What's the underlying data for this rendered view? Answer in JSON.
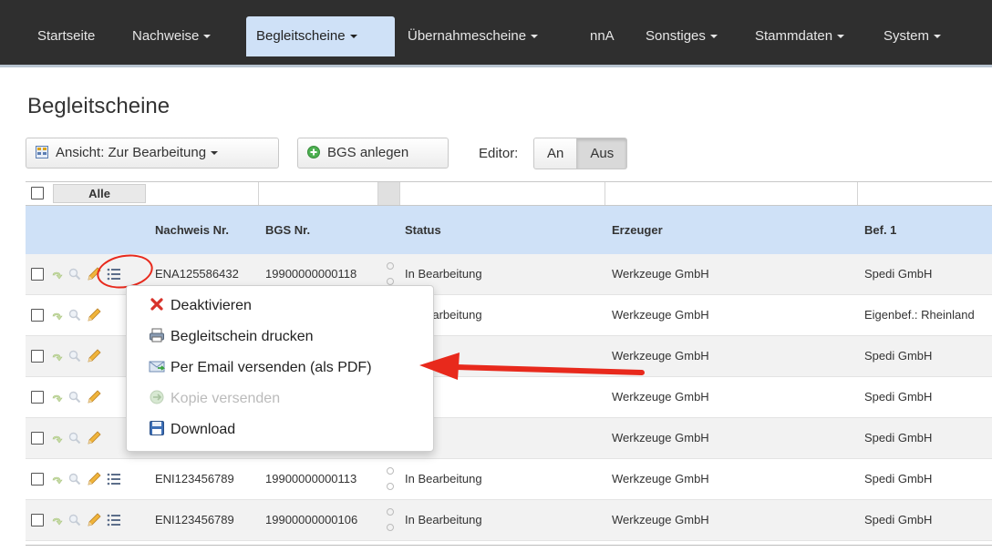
{
  "nav": {
    "items": [
      {
        "label": "Startseite",
        "caret": false
      },
      {
        "label": "Nachweise",
        "caret": true
      },
      {
        "label": "Begleitscheine",
        "caret": true,
        "active": true
      },
      {
        "label": "Übernahmescheine",
        "caret": true
      },
      {
        "label": "nnA",
        "caret": false
      },
      {
        "label": "Sonstiges",
        "caret": true
      },
      {
        "label": "Stammdaten",
        "caret": true
      },
      {
        "label": "System",
        "caret": true
      }
    ]
  },
  "page_title": "Begleitscheine",
  "toolbar": {
    "view_label": "Ansicht: Zur Bearbeitung",
    "create_label": "BGS anlegen",
    "editor_label": "Editor:",
    "editor_on": "An",
    "editor_off": "Aus"
  },
  "grid": {
    "select_all": "Alle",
    "columns": {
      "nachweis": "Nachweis Nr.",
      "bgs": "BGS Nr.",
      "status": "Status",
      "erzeuger": "Erzeuger",
      "bef1": "Bef. 1"
    },
    "rows": [
      {
        "nachweis": "ENA125586432",
        "bgs": "19900000000118",
        "status": "In Bearbeitung",
        "erzeuger": "Werkzeuge GmbH",
        "bef1": "Spedi GmbH"
      },
      {
        "nachweis": "",
        "bgs": "",
        "status": "In Bearbeitung",
        "erzeuger": "Werkzeuge GmbH",
        "bef1": "Eigenbef.: Rheinland"
      },
      {
        "nachweis": "",
        "bgs": "",
        "status": "",
        "erzeuger": "Werkzeuge GmbH",
        "bef1": "Spedi GmbH"
      },
      {
        "nachweis": "",
        "bgs": "",
        "status": "",
        "erzeuger": "Werkzeuge GmbH",
        "bef1": "Spedi GmbH"
      },
      {
        "nachweis": "",
        "bgs": "",
        "status": "",
        "erzeuger": "Werkzeuge GmbH",
        "bef1": "Spedi GmbH"
      },
      {
        "nachweis": "ENI123456789",
        "bgs": "19900000000113",
        "status": "In Bearbeitung",
        "erzeuger": "Werkzeuge GmbH",
        "bef1": "Spedi GmbH"
      },
      {
        "nachweis": "ENI123456789",
        "bgs": "19900000000106",
        "status": "In Bearbeitung",
        "erzeuger": "Werkzeuge GmbH",
        "bef1": "Spedi GmbH"
      }
    ]
  },
  "context_menu": {
    "items": [
      {
        "label": "Deaktivieren",
        "icon": "red-x-icon",
        "disabled": false
      },
      {
        "label": "Begleitschein drucken",
        "icon": "printer-icon",
        "disabled": false
      },
      {
        "label": "Per Email versenden (als PDF)",
        "icon": "email-icon",
        "disabled": false
      },
      {
        "label": "Kopie versenden",
        "icon": "copy-send-icon",
        "disabled": true
      },
      {
        "label": "Download",
        "icon": "floppy-disk-icon",
        "disabled": false
      }
    ]
  },
  "colors": {
    "navbar_bg": "#2f2f2f",
    "nav_active_bg": "#cfe1f7",
    "header_bg": "#cfe1f7",
    "annotation": "#e8291c"
  }
}
